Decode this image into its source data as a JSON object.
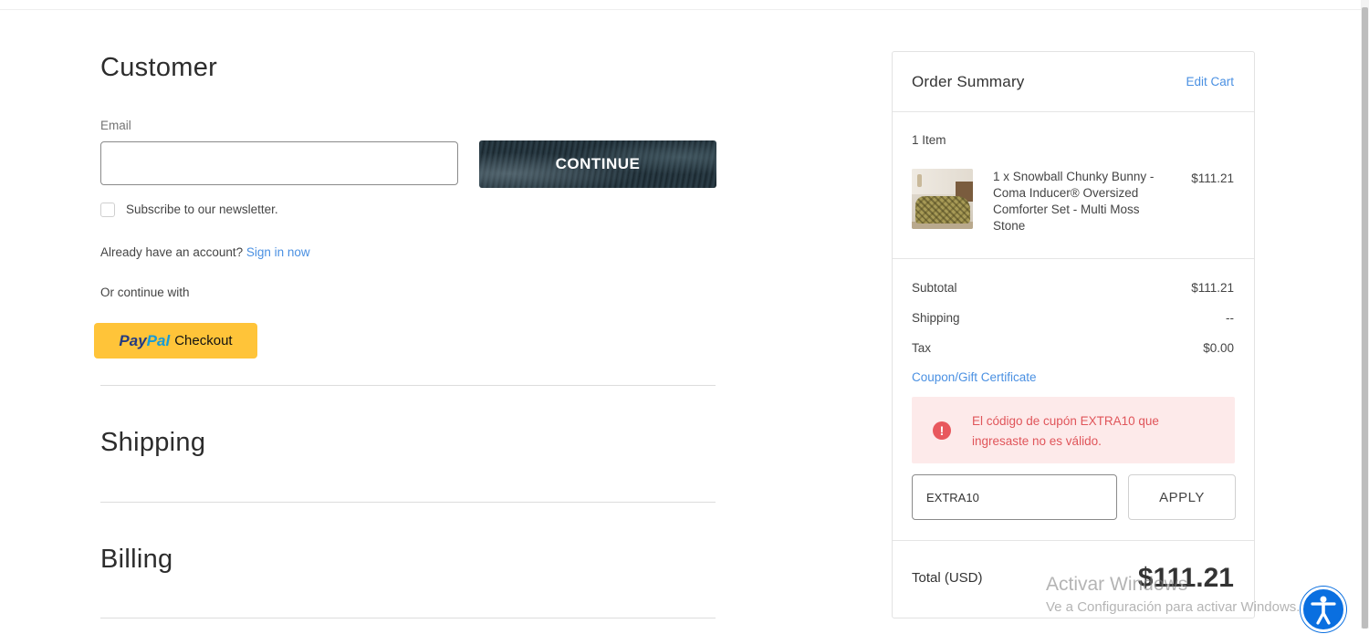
{
  "customer": {
    "title": "Customer",
    "email_label": "Email",
    "email_value": "",
    "continue_label": "CONTINUE",
    "newsletter_label": "Subscribe to our newsletter.",
    "account_prompt": "Already have an account?",
    "sign_in_link": "Sign in now",
    "or_continue": "Or continue with",
    "paypal": {
      "brand_pay": "Pay",
      "brand_pal": "Pal",
      "label": "Checkout"
    }
  },
  "sections": {
    "shipping": "Shipping",
    "billing": "Billing"
  },
  "summary": {
    "title": "Order Summary",
    "edit_cart": "Edit Cart",
    "item_count": "1 Item",
    "item": {
      "name": "1 x Snowball Chunky Bunny - Coma Inducer® Oversized Comforter Set - Multi Moss Stone",
      "price": "$111.21"
    },
    "subtotal_label": "Subtotal",
    "subtotal_value": "$111.21",
    "shipping_label": "Shipping",
    "shipping_value": "--",
    "tax_label": "Tax",
    "tax_value": "$0.00",
    "coupon_link": "Coupon/Gift Certificate",
    "alert_icon": "!",
    "alert_message": "El código de cupón EXTRA10 que ingresaste no es válido.",
    "coupon_value": "EXTRA10",
    "apply_label": "APPLY",
    "total_label": "Total (USD)",
    "total_value": "$111.21"
  },
  "watermark": {
    "line1": "Activar Windows",
    "line2": "Ve a Configuración para activar Windows."
  },
  "colors": {
    "link": "#4a90e2",
    "paypal": "#ffc439",
    "error": "#e0555a",
    "error_bg": "#fdeaea",
    "accessibility": "#0a6fe0"
  },
  "icons": {
    "alert": "error-circle-icon",
    "accessibility": "accessibility-person-icon"
  }
}
